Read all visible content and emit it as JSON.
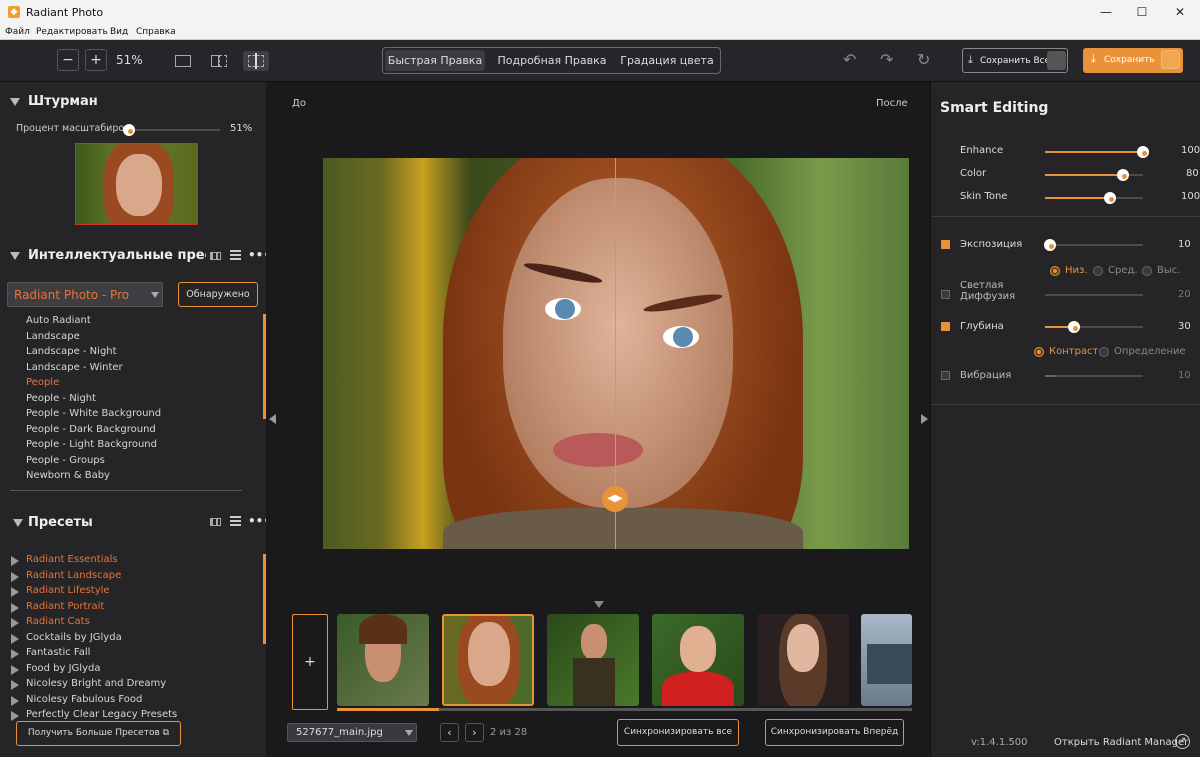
{
  "window": {
    "title": "Radiant Photo",
    "minimize": "—",
    "maximize": "☐",
    "close": "✕"
  },
  "menu": [
    "Файл",
    "Редактировать",
    "Вид",
    "Справка"
  ],
  "toolbar": {
    "zoom_out": "−",
    "zoom_in": "+",
    "zoom_level": "51%",
    "tabs": [
      "Быстрая Правка",
      "Подробная Правка",
      "Градация цвета"
    ],
    "active_tab": "Быстрая Правка",
    "save_all_label": "Сохранить Все",
    "save_label": "Сохранить",
    "undo_icon": "↶",
    "redo_icon": "↷",
    "reset_icon": "↻"
  },
  "navigator": {
    "title": "Штурман",
    "zoom_label": "Процент масштабиро",
    "zoom_value": "51%",
    "zoom_fraction": 0.0
  },
  "smart_presets": {
    "title": "Интеллектуальные пресеты",
    "dropdown_value": "Radiant Photo - Pro",
    "detected_label": "Обнаружено",
    "items": [
      "Auto Radiant",
      "Landscape",
      "Landscape - Night",
      "Landscape - Winter",
      "People",
      "People - Night",
      "People - White Background",
      "People - Dark Background",
      "People - Light Background",
      "People - Groups",
      "Newborn & Baby"
    ],
    "selected": "People"
  },
  "presets": {
    "title": "Пресеты",
    "items": [
      {
        "label": "Radiant Essentials",
        "highlight": true
      },
      {
        "label": "Radiant Landscape",
        "highlight": true
      },
      {
        "label": "Radiant Lifestyle",
        "highlight": true
      },
      {
        "label": "Radiant Portrait",
        "highlight": true
      },
      {
        "label": "Radiant Cats",
        "highlight": true
      },
      {
        "label": "Cocktails by JGlyda",
        "highlight": false
      },
      {
        "label": "Fantastic Fall",
        "highlight": false
      },
      {
        "label": "Food by JGlyda",
        "highlight": false
      },
      {
        "label": "Nicolesy Bright and Dreamy",
        "highlight": false
      },
      {
        "label": "Nicolesy Fabulous Food",
        "highlight": false
      },
      {
        "label": "Perfectly Clear Legacy Presets",
        "highlight": false
      }
    ],
    "more_button": "Получить Больше Пресетов"
  },
  "canvas": {
    "before_label": "До",
    "after_label": "После"
  },
  "filmstrip": {
    "add_label": "+",
    "filename": "527677_main.jpg",
    "page_info": "2 из 28",
    "sync_all": "Синхронизировать все",
    "sync_forward": "Синхронизировать Вперёд"
  },
  "smart_editing": {
    "title": "Smart Editing",
    "sliders": [
      {
        "label": "Enhance",
        "value": "100",
        "fraction": 1.0
      },
      {
        "label": "Color",
        "value": "80",
        "fraction": 0.8
      },
      {
        "label": "Skin Tone",
        "value": "100",
        "fraction": 0.66
      }
    ]
  },
  "adjustments": [
    {
      "label": "Экспозиция",
      "checked": true,
      "value": "10",
      "fraction": 0.05
    },
    {
      "label": "Светлая Диффузия",
      "checked": false,
      "value": "20",
      "fraction": 0.0
    },
    {
      "label": "Глубина",
      "checked": true,
      "value": "30",
      "fraction": 0.3
    },
    {
      "label": "Вибрация",
      "checked": false,
      "value": "10",
      "fraction": 0.1
    }
  ],
  "exposure_radios": [
    "Низ.",
    "Сред.",
    "Выс."
  ],
  "depth_radios": [
    "Контраст",
    "Определение"
  ],
  "footer": {
    "version": "v:1.4.1.500",
    "open_manager": "Открыть Radiant Manager"
  },
  "colors": {
    "accent": "#e8933a",
    "highlight": "#e8733a",
    "panel": "#252528"
  }
}
